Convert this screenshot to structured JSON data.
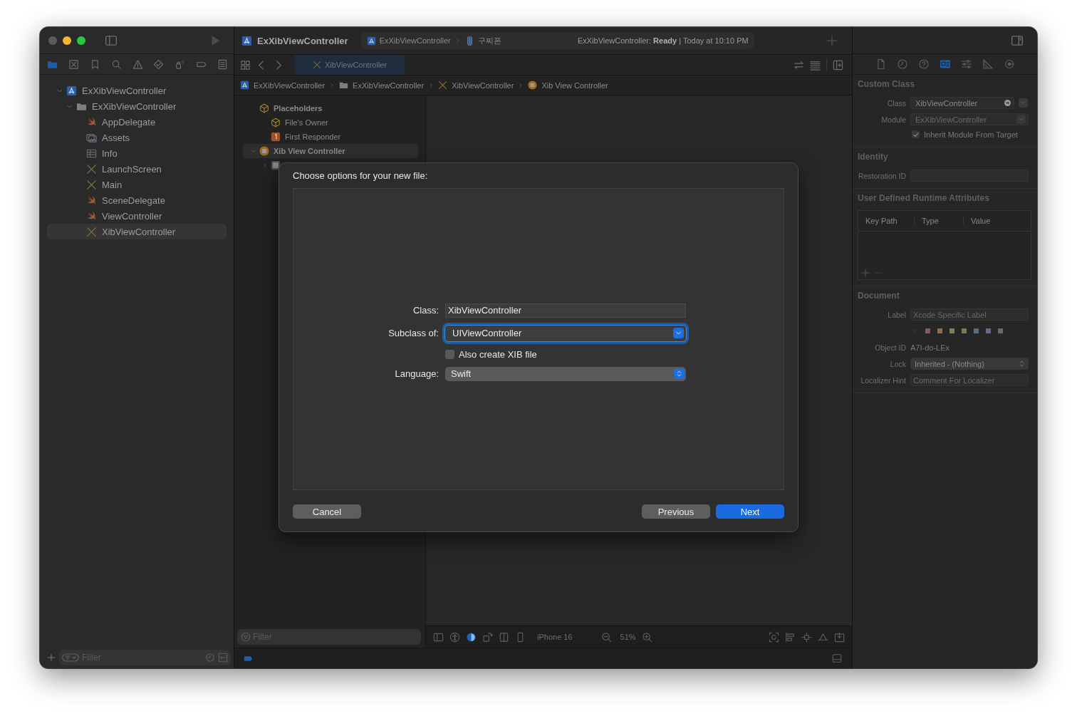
{
  "toolbar": {
    "project": "ExXibViewController",
    "scheme_target": "ExXibViewController",
    "scheme_device": "구찌폰",
    "activity": "ExXibViewController: **Ready** | Today at 10:10 PM"
  },
  "navigator": {
    "tabs": [
      {
        "kind": "folder",
        "selected": true
      },
      {
        "kind": "source-control",
        "selected": false
      },
      {
        "kind": "bookmark",
        "selected": false
      },
      {
        "kind": "search",
        "selected": false
      },
      {
        "kind": "warning",
        "selected": false
      },
      {
        "kind": "test",
        "selected": false
      },
      {
        "kind": "debug",
        "selected": false
      },
      {
        "kind": "breakpoint",
        "selected": false
      },
      {
        "kind": "report",
        "selected": false
      }
    ],
    "tree": [
      {
        "label": "ExXibViewController",
        "kind": "project",
        "expanded": true,
        "children": [
          {
            "label": "ExXibViewController",
            "kind": "folder",
            "expanded": true,
            "children": [
              {
                "label": "AppDelegate",
                "kind": "swift",
                "selected": false
              },
              {
                "label": "Assets",
                "kind": "assets",
                "selected": false
              },
              {
                "label": "Info",
                "kind": "plist",
                "selected": false
              },
              {
                "label": "LaunchScreen",
                "kind": "xib",
                "selected": false
              },
              {
                "label": "Main",
                "kind": "xib",
                "selected": false
              },
              {
                "label": "SceneDelegate",
                "kind": "swift",
                "selected": false
              },
              {
                "label": "ViewController",
                "kind": "swift",
                "selected": false
              },
              {
                "label": "XibViewController",
                "kind": "xib",
                "selected": true
              }
            ]
          }
        ]
      }
    ],
    "filter": {
      "placeholder": "Filter"
    }
  },
  "editor": {
    "tabs": [
      {
        "label": "XibViewController",
        "kind": "xib",
        "selected": true
      }
    ],
    "breadcrumbs": [
      {
        "label": "ExXibViewController",
        "kind": "project"
      },
      {
        "label": "ExXibViewController",
        "kind": "folder"
      },
      {
        "label": "XibViewController",
        "kind": "xib"
      },
      {
        "label": "Xib View Controller",
        "kind": "controller"
      }
    ],
    "outline": [
      {
        "label": "Placeholders",
        "kind": "placeholders",
        "selected": false,
        "children": [
          {
            "label": "File's Owner",
            "kind": "placeholders",
            "selected": false
          },
          {
            "label": "First Responder",
            "kind": "responder",
            "selected": false
          }
        ]
      },
      {
        "label": "Xib View Controller",
        "kind": "controller",
        "expanded": true,
        "selected": true,
        "children": [
          {
            "kind": "view",
            "expanded": false,
            "selected": false
          }
        ]
      }
    ],
    "outline_filter": {
      "placeholder": "Filter"
    },
    "canvas_toolbar": {
      "device": "iPhone 16",
      "zoom": "51%"
    }
  },
  "inspector": {
    "tabs": [
      {
        "kind": "file",
        "selected": false
      },
      {
        "kind": "history",
        "selected": false
      },
      {
        "kind": "help",
        "selected": false
      },
      {
        "kind": "identity",
        "selected": true
      },
      {
        "kind": "attributes",
        "selected": false
      },
      {
        "kind": "size",
        "selected": false
      },
      {
        "kind": "connections",
        "selected": false
      }
    ],
    "custom_class": {
      "title": "Custom Class",
      "class_label": "Class",
      "class_value": "XibViewController",
      "module_label": "Module",
      "module_value": "ExXibViewController",
      "module_disabled": true,
      "inherit_label": "Inherit Module From Target",
      "inherit_checked": true
    },
    "identity": {
      "title": "Identity",
      "restoration_label": "Restoration ID"
    },
    "runtime_attributes": {
      "title": "User Defined Runtime Attributes",
      "columns": [
        "Key Path",
        "Type",
        "Value"
      ]
    },
    "document": {
      "title": "Document",
      "label_label": "Label",
      "label_placeholder": "Xcode Specific Label",
      "colors": [
        {
          "color": "#8a5858"
        },
        {
          "color": "#8a6f50"
        },
        {
          "color": "#858050"
        },
        {
          "color": "#6e7f50"
        },
        {
          "color": "#50708a"
        },
        {
          "color": "#74608a"
        },
        {
          "color": "#6a6a6a"
        }
      ],
      "object_id_label": "Object ID",
      "object_id": "A7I-do-LEx",
      "lock_label": "Lock",
      "lock_value": "Inherited - (Nothing)",
      "hint_label": "Localizer Hint",
      "hint_placeholder": "Comment For Localizer"
    }
  },
  "dialog": {
    "title": "Choose options for your new file:",
    "fields": [
      {
        "kind": "text",
        "label": "Class:",
        "value": "XibViewController"
      },
      {
        "kind": "combo",
        "label": "Subclass of:",
        "value": "UIViewController",
        "focused": true
      },
      {
        "kind": "checkbox",
        "label": "Also create XIB file",
        "checked": false
      },
      {
        "kind": "popup",
        "label": "Language:",
        "value": "Swift"
      }
    ],
    "buttons": [
      {
        "label": "Cancel",
        "default": false
      },
      {
        "label": "Previous",
        "default": false
      },
      {
        "label": "Next",
        "default": true
      }
    ]
  }
}
